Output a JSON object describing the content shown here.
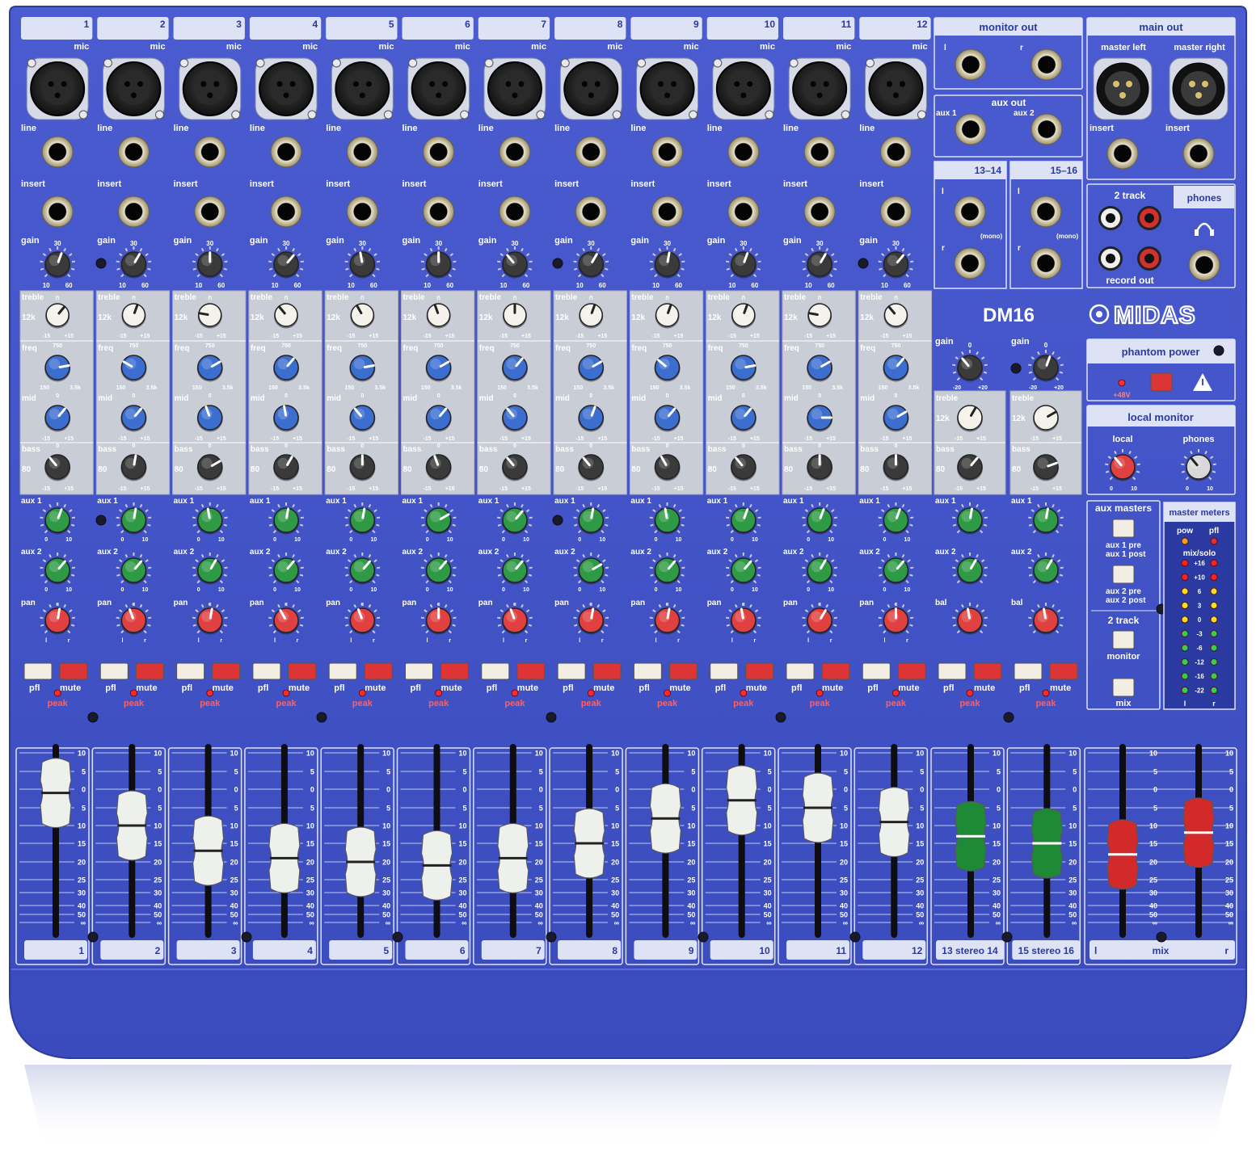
{
  "model": "DM16",
  "brand": "MIDAS",
  "colors": {
    "panel": "#3f51c8",
    "panel_dark": "#2a3a9c",
    "label_bg": "#dde3f4",
    "knob_white": "#f4f2ea",
    "knob_blue": "#3c6ed0",
    "knob_green": "#2f9a46",
    "knob_red": "#e04040",
    "knob_black": "#3a3a3a",
    "mute": "#dd3535",
    "fader_white": "#eef0ec",
    "fader_green": "#1f8a36",
    "fader_red": "#d22a2a"
  },
  "channels": {
    "numbers": [
      "1",
      "2",
      "3",
      "4",
      "5",
      "6",
      "7",
      "8",
      "9",
      "10",
      "11",
      "12"
    ],
    "labels": {
      "mic": "mic",
      "line": "line",
      "insert": "insert",
      "gain": "gain",
      "treble": "treble",
      "freq": "freq",
      "mid": "mid",
      "bass": "bass",
      "aux1": "aux 1",
      "aux2": "aux 2",
      "pan": "pan",
      "pfl": "pfl",
      "mute": "mute",
      "peak": "peak"
    },
    "scales": {
      "gain_min": "10",
      "gain_mid": "30",
      "gain_max": "60",
      "eq_min": "-15",
      "eq_zero": "0",
      "eq_max": "+15",
      "treble_freq": "12k",
      "bass_freq": "80",
      "freq_min": "150",
      "freq_mid": "750",
      "freq_max": "3.5k",
      "aux_min": "0",
      "aux_max": "10",
      "pan_l": "l",
      "pan_c": "c",
      "pan_r": "r"
    },
    "fader_levels_db": [
      -1,
      -10,
      -17,
      -19,
      -20,
      -21,
      -19,
      -15,
      -8,
      -3,
      -5,
      -9
    ]
  },
  "stereo": {
    "inputs": [
      "13–14",
      "15–16"
    ],
    "mono": "(mono)",
    "gain_min": "-20",
    "gain_mid": "0",
    "gain_max": "+20",
    "bal": "bal",
    "fader_labels": [
      "13 stereo 14",
      "15 stereo 16"
    ],
    "fader_levels_db": [
      -13,
      -15
    ]
  },
  "outputs": {
    "monitor_out": "monitor out",
    "aux_out": "aux out",
    "aux1": "aux 1",
    "aux2": "aux 2",
    "l": "l",
    "r": "r",
    "main_out": "main out",
    "master_left": "master left",
    "master_right": "master right",
    "insert": "insert",
    "two_track": "2 track",
    "record_out": "record out",
    "phones": "phones"
  },
  "master": {
    "phantom_power": "phantom power",
    "plus48": "+48V",
    "local_monitor": "local monitor",
    "local": "local",
    "phones": "phones",
    "aux_masters": "aux masters",
    "aux1_pre": "aux 1 pre",
    "aux1_post": "aux 1 post",
    "aux2_pre": "aux 2 pre",
    "aux2_post": "aux 2 post",
    "two_track": "2 track",
    "monitor": "monitor",
    "mix": "mix",
    "master_meters": "master meters",
    "pow": "pow",
    "pfl": "pfl",
    "mix_solo": "mix/solo",
    "meter_scale": [
      "+16",
      "+10",
      "6",
      "3",
      "0",
      "-3",
      "-6",
      "-12",
      "-16",
      "-22"
    ],
    "meter_l": "l",
    "meter_r": "r",
    "mix_fader_label": "mix",
    "mix_l": "l",
    "mix_r": "r",
    "mix_levels_db": [
      -18,
      -12
    ]
  },
  "fader_scale": [
    "10",
    "5",
    "0",
    "5",
    "10",
    "15",
    "20",
    "25",
    "30",
    "40",
    "50",
    "∞"
  ]
}
